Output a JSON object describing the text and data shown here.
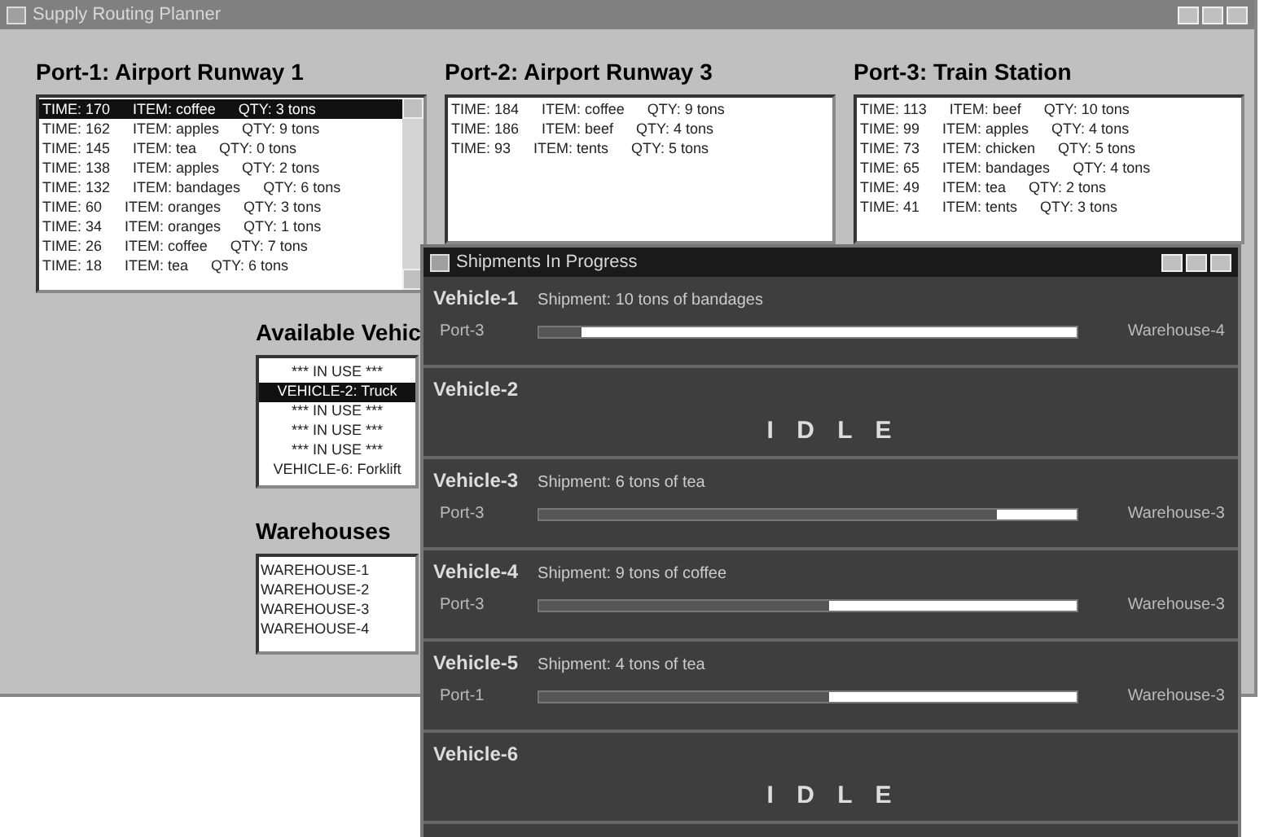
{
  "window": {
    "title": "Supply Routing Planner"
  },
  "ports": [
    {
      "title": "Port-1: Airport Runway 1",
      "rows": [
        {
          "time": "TIME: 170",
          "item": "ITEM: coffee",
          "qty": "QTY: 3 tons",
          "selected": true
        },
        {
          "time": "TIME: 162",
          "item": "ITEM: apples",
          "qty": "QTY: 9 tons",
          "selected": false
        },
        {
          "time": "TIME: 145",
          "item": "ITEM: tea",
          "qty": "QTY: 0 tons",
          "selected": false
        },
        {
          "time": "TIME: 138",
          "item": "ITEM: apples",
          "qty": "QTY: 2 tons",
          "selected": false
        },
        {
          "time": "TIME: 132",
          "item": "ITEM: bandages",
          "qty": "QTY: 6 tons",
          "selected": false
        },
        {
          "time": "TIME: 60",
          "item": "ITEM: oranges",
          "qty": "QTY: 3 tons",
          "selected": false
        },
        {
          "time": "TIME: 34",
          "item": "ITEM: oranges",
          "qty": "QTY: 1 tons",
          "selected": false
        },
        {
          "time": "TIME: 26",
          "item": "ITEM: coffee",
          "qty": "QTY: 7 tons",
          "selected": false
        },
        {
          "time": "TIME: 18",
          "item": "ITEM: tea",
          "qty": "QTY: 6 tons",
          "selected": false
        }
      ]
    },
    {
      "title": "Port-2: Airport Runway 3",
      "rows": [
        {
          "time": "TIME: 184",
          "item": "ITEM: coffee",
          "qty": "QTY: 9 tons",
          "selected": false
        },
        {
          "time": "TIME: 186",
          "item": "ITEM: beef",
          "qty": "QTY: 4 tons",
          "selected": false
        },
        {
          "time": "TIME: 93",
          "item": "ITEM: tents",
          "qty": "QTY: 5 tons",
          "selected": false
        }
      ]
    },
    {
      "title": "Port-3: Train Station",
      "rows": [
        {
          "time": "TIME: 113",
          "item": "ITEM: beef",
          "qty": "QTY: 10 tons",
          "selected": false
        },
        {
          "time": "TIME: 99",
          "item": "ITEM: apples",
          "qty": "QTY: 4 tons",
          "selected": false
        },
        {
          "time": "TIME: 73",
          "item": "ITEM: chicken",
          "qty": "QTY: 5 tons",
          "selected": false
        },
        {
          "time": "TIME: 65",
          "item": "ITEM: bandages",
          "qty": "QTY: 4 tons",
          "selected": false
        },
        {
          "time": "TIME: 49",
          "item": "ITEM: tea",
          "qty": "QTY: 2 tons",
          "selected": false
        },
        {
          "time": "TIME: 41",
          "item": "ITEM: tents",
          "qty": "QTY: 3 tons",
          "selected": false
        }
      ]
    }
  ],
  "vehicles": {
    "title": "Available Vehic",
    "items": [
      {
        "label": "*** IN USE ***",
        "selected": false
      },
      {
        "label": "VEHICLE-2: Truck",
        "selected": true
      },
      {
        "label": "*** IN USE ***",
        "selected": false
      },
      {
        "label": "*** IN USE ***",
        "selected": false
      },
      {
        "label": "*** IN USE ***",
        "selected": false
      },
      {
        "label": "VEHICLE-6: Forklift",
        "selected": false
      }
    ]
  },
  "warehouses": {
    "title": "Warehouses",
    "items": [
      "WAREHOUSE-1",
      "WAREHOUSE-2",
      "WAREHOUSE-3",
      "WAREHOUSE-4"
    ]
  },
  "shipments_window": {
    "title": "Shipments In Progress",
    "rows": [
      {
        "kind": "moving",
        "vehicle": "Vehicle-1",
        "shipment": "Shipment: 10 tons of bandages",
        "from": "Port-3",
        "to": "Warehouse-4",
        "level": 0.08
      },
      {
        "kind": "idle",
        "vehicle": "Vehicle-2",
        "status": "I D L E"
      },
      {
        "kind": "moving",
        "vehicle": "Vehicle-3",
        "shipment": "Shipment: 6 tons of tea",
        "from": "Port-3",
        "to": "Warehouse-3",
        "level": 0.85
      },
      {
        "kind": "moving",
        "vehicle": "Vehicle-4",
        "shipment": "Shipment: 9 tons of coffee",
        "from": "Port-3",
        "to": "Warehouse-3",
        "level": 0.54
      },
      {
        "kind": "moving",
        "vehicle": "Vehicle-5",
        "shipment": "Shipment: 4 tons of tea",
        "from": "Port-1",
        "to": "Warehouse-3",
        "level": 0.54
      },
      {
        "kind": "idle",
        "vehicle": "Vehicle-6",
        "status": "I D L E"
      }
    ]
  }
}
